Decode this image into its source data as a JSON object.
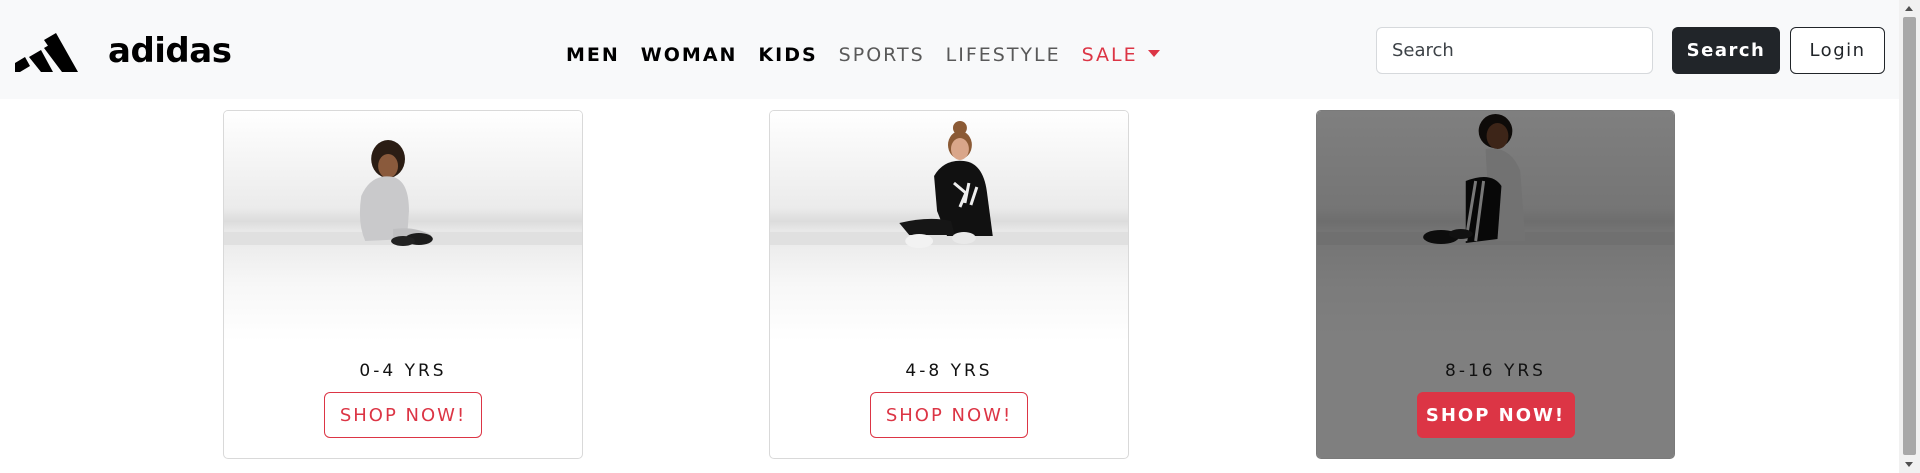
{
  "brand": {
    "name": "adidas",
    "logo_icon": "adidas-logo-icon"
  },
  "nav": {
    "links": [
      {
        "label": "MEN"
      },
      {
        "label": "WOMAN"
      },
      {
        "label": "KIDS"
      },
      {
        "label": "SPORTS"
      },
      {
        "label": "LIFESTYLE"
      },
      {
        "label": "SALE"
      }
    ]
  },
  "search": {
    "placeholder": "Search",
    "button_label": "Search"
  },
  "login": {
    "label": "Login"
  },
  "cards": [
    {
      "label": "0-4 YRS",
      "button": "SHOP NOW!"
    },
    {
      "label": "4-8 YRS",
      "button": "SHOP NOW!"
    },
    {
      "label": "8-16 YRS",
      "button": "SHOP NOW!"
    }
  ],
  "colors": {
    "accent": "#dc3545",
    "navbar_bg": "#f8f9fa",
    "dark_button": "#212529"
  }
}
